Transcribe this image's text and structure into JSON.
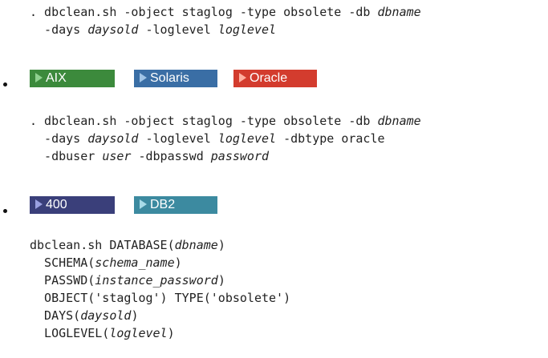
{
  "block1": {
    "l1_cmd": ". dbclean.sh -object staglog -type obsolete -db ",
    "l1_db": "dbname",
    "l2_days_opt": "  -days ",
    "l2_days": "daysold",
    "l2_log_opt": " -loglevel ",
    "l2_log": "loglevel"
  },
  "row1": {
    "badges": [
      {
        "label": "AIX",
        "color": "#3c8a3c",
        "arrow": "#8fd18f"
      },
      {
        "label": "Solaris",
        "color": "#3a6ea5",
        "arrow": "#9fc3e6"
      },
      {
        "label": "Oracle",
        "color": "#d33c2e",
        "arrow": "#ffb0a0"
      }
    ]
  },
  "block2": {
    "l1_cmd": ". dbclean.sh -object staglog -type obsolete -db ",
    "l1_db": "dbname",
    "l2_days_opt": "  -days ",
    "l2_days": "daysold",
    "l2_log_opt": " -loglevel ",
    "l2_log": "loglevel",
    "l2_tail": " -dbtype oracle",
    "l3_user_opt": "  -dbuser ",
    "l3_user": "user",
    "l3_pw_opt": " -dbpasswd ",
    "l3_pw": "password"
  },
  "row2": {
    "badges": [
      {
        "label": "400",
        "color": "#3a3f7a",
        "arrow": "#9aa0e0"
      },
      {
        "label": "DB2",
        "color": "#3c8aa0",
        "arrow": "#a8dbe8"
      }
    ]
  },
  "block3": {
    "l1_a": "dbclean.sh DATABASE(",
    "l1_v": "dbname",
    "l1_b": ")",
    "l2_a": "  SCHEMA(",
    "l2_v": "schema_name",
    "l2_b": ")",
    "l3_a": "  PASSWD(",
    "l3_v": "instance_password",
    "l3_b": ")",
    "l4": "  OBJECT('staglog') TYPE('obsolete')",
    "l5_a": "  DAYS(",
    "l5_v": "daysold",
    "l5_b": ")",
    "l6_a": "  LOGLEVEL(",
    "l6_v": "loglevel",
    "l6_b": ")"
  }
}
